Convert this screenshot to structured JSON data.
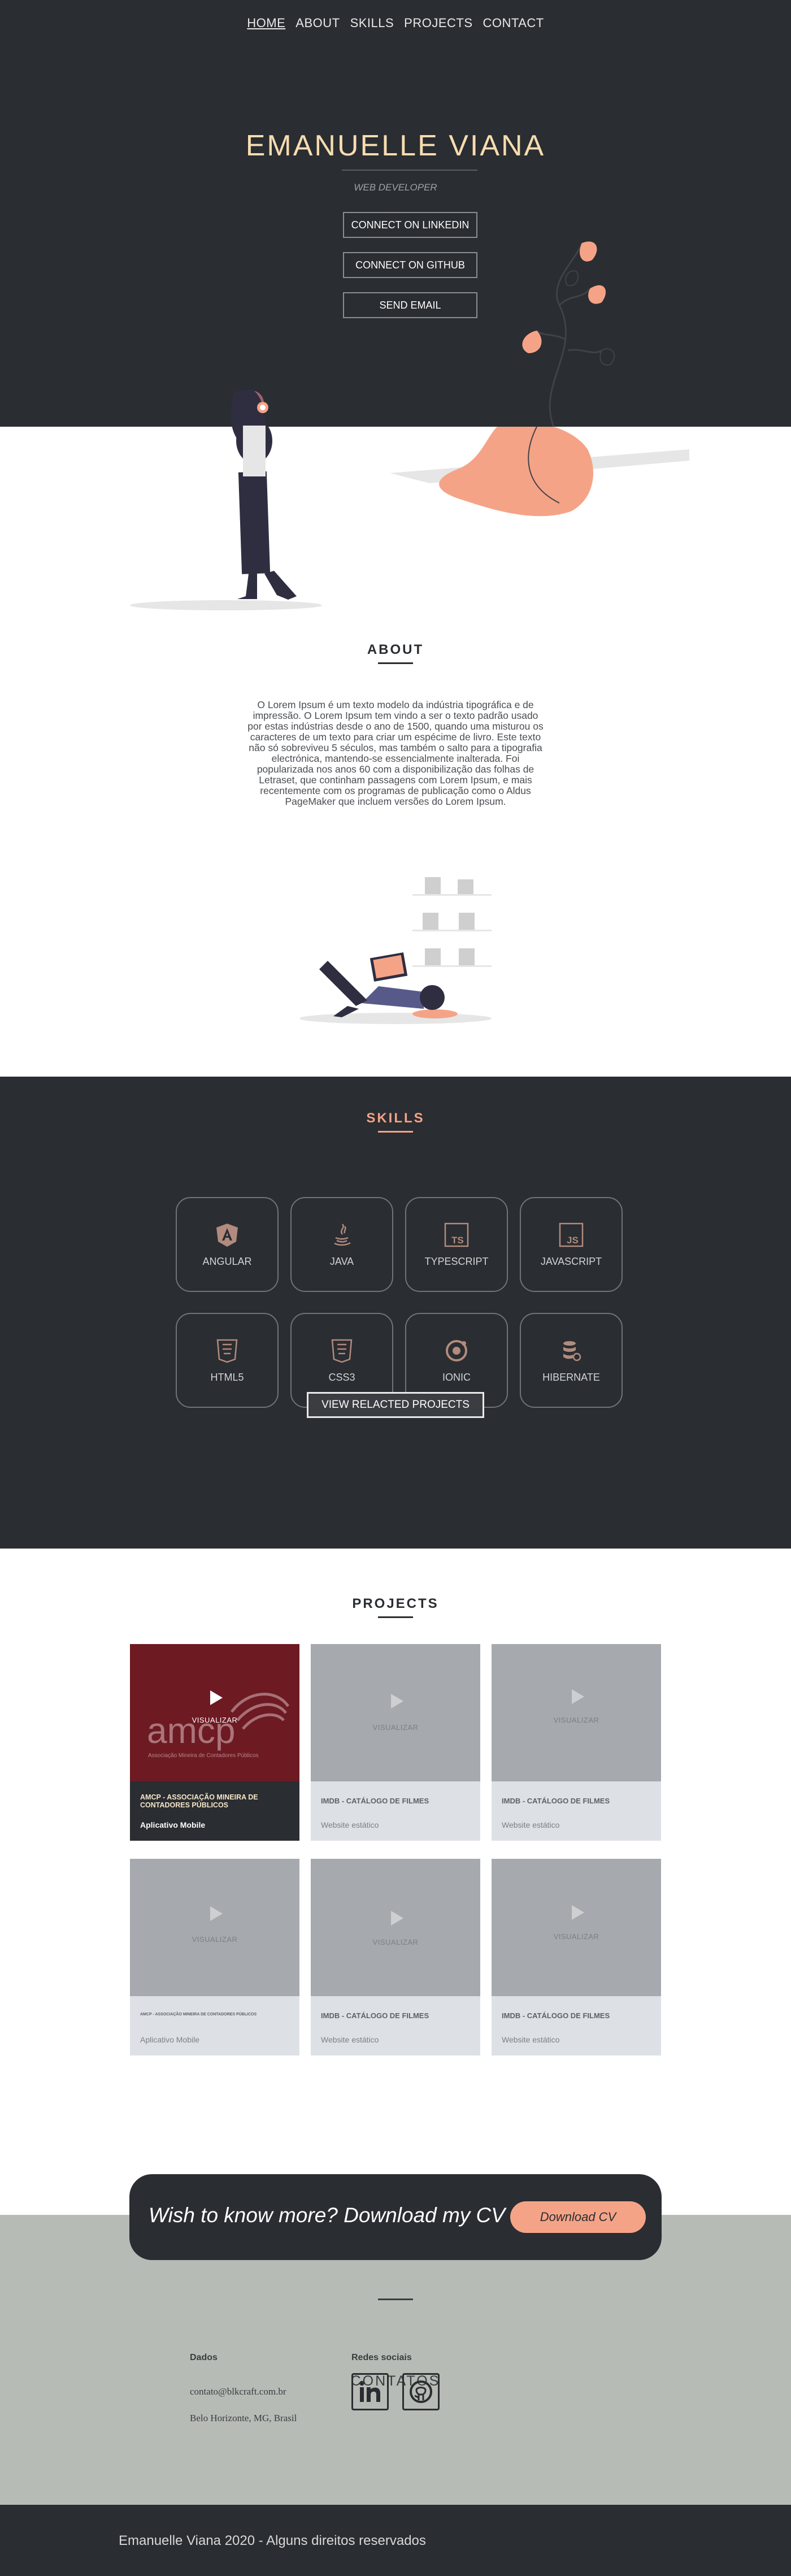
{
  "nav": {
    "items": [
      {
        "label": "HOME",
        "active": true
      },
      {
        "label": "ABOUT"
      },
      {
        "label": "SKILLS"
      },
      {
        "label": "PROJECTS"
      },
      {
        "label": "CONTACT"
      }
    ]
  },
  "hero": {
    "name": "EMANUELLE VIANA",
    "role": "WEB DEVELOPER",
    "buttons": {
      "linkedin": "CONNECT ON LINKEDIN",
      "github": "CONNECT ON GITHUB",
      "email": "SEND EMAIL"
    }
  },
  "about": {
    "title": "ABOUT",
    "text": "O Lorem Ipsum é um texto modelo da indústria tipográfica e de impressão. O Lorem Ipsum tem vindo a ser o texto padrão usado por estas indústrias desde o ano de 1500, quando uma misturou os caracteres de um texto para criar um espécime de livro. Este texto não só sobreviveu 5 séculos, mas também o salto para a tipografia electrónica, mantendo-se essencialmente inalterada. Foi popularizada nos anos 60 com a disponibilização das folhas de Letraset, que continham passagens com Lorem Ipsum, e mais recentemente com os programas de publicação como o Aldus PageMaker que incluem versões do Lorem Ipsum."
  },
  "skills": {
    "title": "SKILLS",
    "items": [
      {
        "label": "ANGULAR",
        "icon": "angular-icon"
      },
      {
        "label": "JAVA",
        "icon": "java-icon"
      },
      {
        "label": "TYPESCRIPT",
        "icon": "typescript-icon"
      },
      {
        "label": "JAVASCRIPT",
        "icon": "javascript-icon"
      },
      {
        "label": "HTML5",
        "icon": "html5-icon"
      },
      {
        "label": "CSS3",
        "icon": "css3-icon"
      },
      {
        "label": "IONIC",
        "icon": "ionic-icon"
      },
      {
        "label": "HIBERNATE",
        "icon": "hibernate-icon"
      }
    ],
    "button": "VIEW RELACTED PROJECTS"
  },
  "projects": {
    "title": "PROJECTS",
    "overlay": "VISUALIZAR",
    "items": [
      {
        "title": "AMCP - ASSOCIAÇÃO MINEIRA DE CONTADORES PÚBLICOS",
        "type": "Aplicativo Mobile",
        "logo_text": "amcp",
        "logo_caption": "Associação Mineira de Contadores Públicos",
        "highlight": true
      },
      {
        "title": "IMDB - CATÁLOGO DE FILMES",
        "type": "Website estático"
      },
      {
        "title": "IMDB - CATÁLOGO DE FILMES",
        "type": "Website estático"
      },
      {
        "title": "AMCP - ASSOCIAÇÃO MINEIRA DE CONTADORES PÚBLICOS",
        "type": "Aplicativo Mobile",
        "small_title": true
      },
      {
        "title": "IMDB - CATÁLOGO DE FILMES",
        "type": "Website estático"
      },
      {
        "title": "IMDB - CATÁLOGO DE FILMES",
        "type": "Website estático"
      }
    ]
  },
  "cv": {
    "text": "Wish to know more? Download my CV",
    "button": "Download CV"
  },
  "contact": {
    "title": "CONTATOS",
    "data_heading": "Dados",
    "email": "contato@blkcraft.com.br",
    "location": "Belo Horizonte, MG, Brasil",
    "social_heading": "Redes sociais",
    "social": [
      {
        "icon": "linkedin-icon"
      },
      {
        "icon": "github-icon"
      }
    ]
  },
  "footer": {
    "text": "Emanuelle Viana 2020 - Alguns direitos reservados"
  },
  "colors": {
    "dark": "#2a2d31",
    "accent": "#f5a387",
    "name": "#f7dcb0",
    "contact_bg": "#b7bbb5"
  }
}
